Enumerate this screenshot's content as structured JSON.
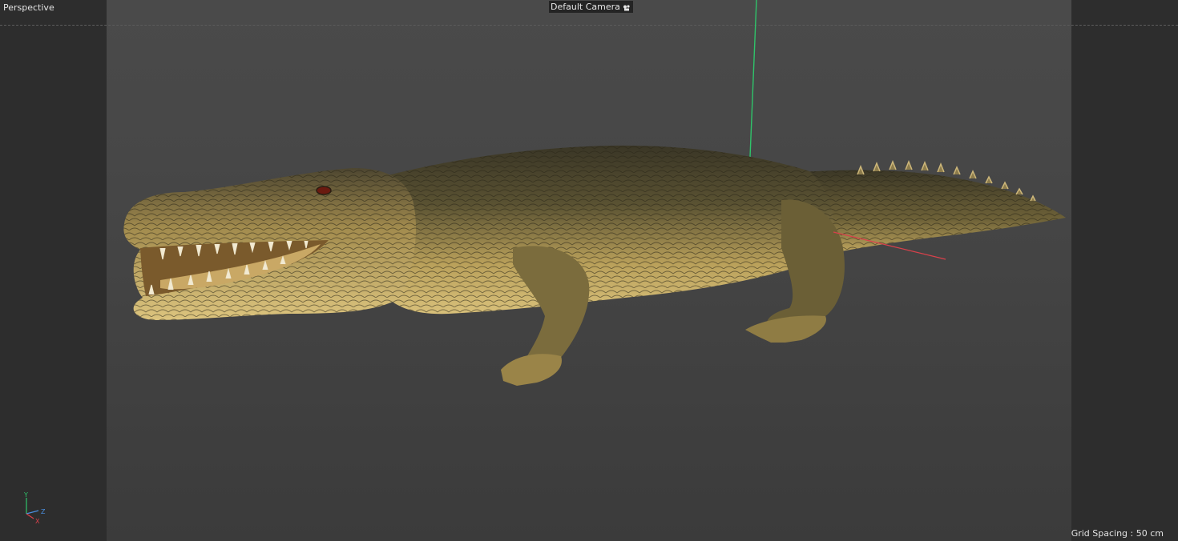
{
  "viewport": {
    "view_name": "Perspective",
    "camera_name": "Default Camera",
    "grid_spacing_label": "Grid Spacing : 50 cm",
    "axis_labels": {
      "y": "Y",
      "z": "Z",
      "x": "X"
    }
  },
  "icons": {
    "camera": "camera-icon",
    "axis_gizmo": "axis-gizmo-icon"
  },
  "colors": {
    "viewport_bg": "#2d2d2d",
    "safe_frame_bg": "#474747",
    "y_axis": "#2fc46a",
    "x_axis": "#d9414b",
    "z_axis": "#4a8fe0",
    "model_light": "#d7bd72",
    "model_dark": "#3d3724"
  }
}
